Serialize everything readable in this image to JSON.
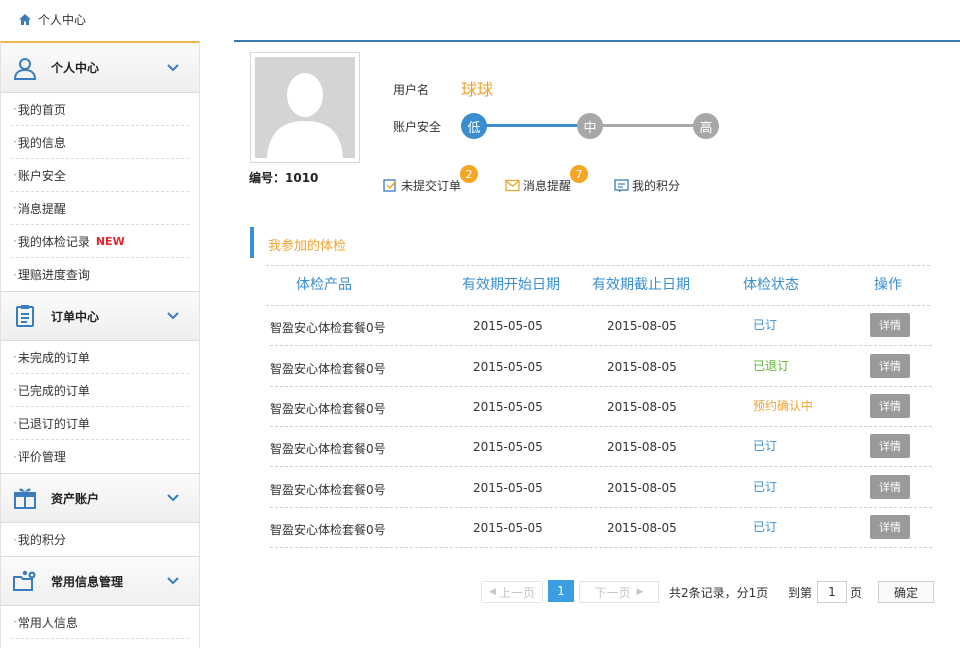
{
  "breadcrumb": {
    "label": "个人中心"
  },
  "sidebar": {
    "sections": [
      {
        "title": "个人中心",
        "items": [
          "我的首页",
          "我的信息",
          "账户安全",
          "消息提醒",
          "我的体检记录",
          "理赔进度查询"
        ],
        "new_badge": "NEW"
      },
      {
        "title": "订单中心",
        "items": [
          "未完成的订单",
          "已完成的订单",
          "已退订的订单",
          "评价管理"
        ]
      },
      {
        "title": "资产账户",
        "items": [
          "我的积分"
        ]
      },
      {
        "title": "常用信息管理",
        "items": [
          "常用人信息"
        ]
      }
    ]
  },
  "profile": {
    "id_label": "编号：1010",
    "username_label": "用户名",
    "username": "球球",
    "security_label": "账户安全",
    "levels": [
      "低",
      "中",
      "高"
    ],
    "quick_links": [
      {
        "label": "未提交订单",
        "badge": "2"
      },
      {
        "label": "消息提醒",
        "badge": "7"
      },
      {
        "label": "我的积分"
      }
    ]
  },
  "checkups": {
    "title": "我参加的体检",
    "headers": [
      "体检产品",
      "有效期开始日期",
      "有效期截止日期",
      "体检状态",
      "操作"
    ],
    "rows": [
      {
        "product": "智盈安心体检套餐0号",
        "start": "2015-05-05",
        "end": "2015-08-05",
        "status": "已订",
        "action": "详情"
      },
      {
        "product": "智盈安心体检套餐0号",
        "start": "2015-05-05",
        "end": "2015-08-05",
        "status": "已退订",
        "action": "详情"
      },
      {
        "product": "智盈安心体检套餐0号",
        "start": "2015-05-05",
        "end": "2015-08-05",
        "status": "预约确认中",
        "action": "详情"
      },
      {
        "product": "智盈安心体检套餐0号",
        "start": "2015-05-05",
        "end": "2015-08-05",
        "status": "已订",
        "action": "详情"
      },
      {
        "product": "智盈安心体检套餐0号",
        "start": "2015-05-05",
        "end": "2015-08-05",
        "status": "已订",
        "action": "详情"
      },
      {
        "product": "智盈安心体检套餐0号",
        "start": "2015-05-05",
        "end": "2015-08-05",
        "status": "已订",
        "action": "详情"
      }
    ]
  },
  "pagination": {
    "prev": "上一页",
    "current": "1",
    "next": "下一页",
    "summary": "共2条记录，分1页",
    "goto_label": "到第",
    "goto_value": "1",
    "page_unit": "页",
    "confirm": "确定"
  },
  "colors": {
    "accent_orange": "#f2a32e",
    "link_blue": "#3a8ed0",
    "status_booked": "#3a8ed0",
    "status_cancelled": "#5cb531",
    "status_pending": "#f2a32e",
    "level_active": "#3a8ed0",
    "level_inactive": "#a7a7a7"
  },
  "icons": [
    "home-icon",
    "user-icon",
    "clipboard-icon",
    "gift-icon",
    "settings-folder-icon",
    "chevron-down-icon",
    "order-icon",
    "mail-icon",
    "points-icon"
  ]
}
